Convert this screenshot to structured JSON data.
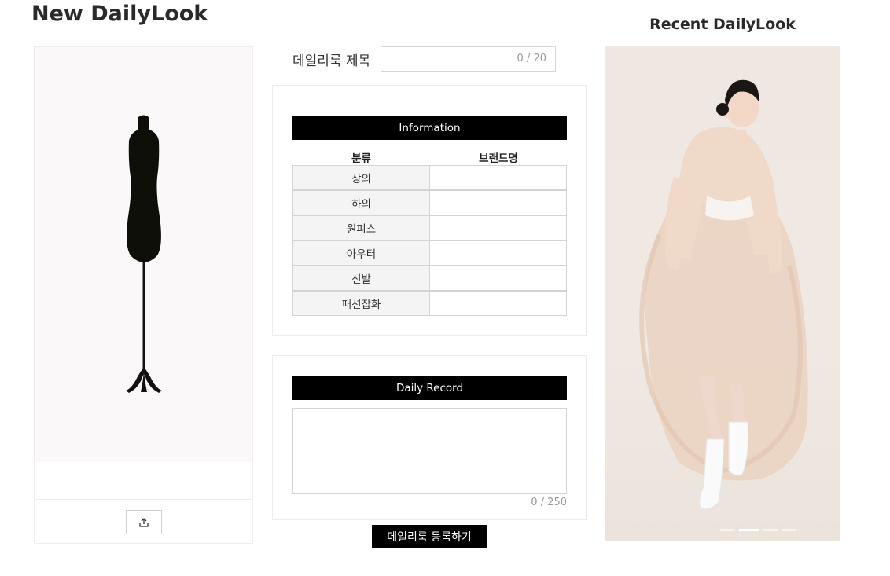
{
  "page": {
    "title": "New DailyLook"
  },
  "left_card": {
    "upload_icon": "upload-icon"
  },
  "title_field": {
    "label": "데일리룩 제목",
    "value": "",
    "counter": "0 / 20"
  },
  "information": {
    "header": "Information",
    "columns": [
      "분류",
      "브랜드명"
    ],
    "rows": [
      {
        "category": "상의",
        "brand": ""
      },
      {
        "category": "하의",
        "brand": ""
      },
      {
        "category": "원피스",
        "brand": ""
      },
      {
        "category": "아우터",
        "brand": ""
      },
      {
        "category": "신발",
        "brand": ""
      },
      {
        "category": "패션잡화",
        "brand": ""
      }
    ]
  },
  "daily_record": {
    "header": "Daily Record",
    "value": "",
    "counter": "0 / 250"
  },
  "submit_label": "데일리룩 등록하기",
  "recent": {
    "title": "Recent DailyLook",
    "slides_total": 4,
    "active_slide": 2
  }
}
